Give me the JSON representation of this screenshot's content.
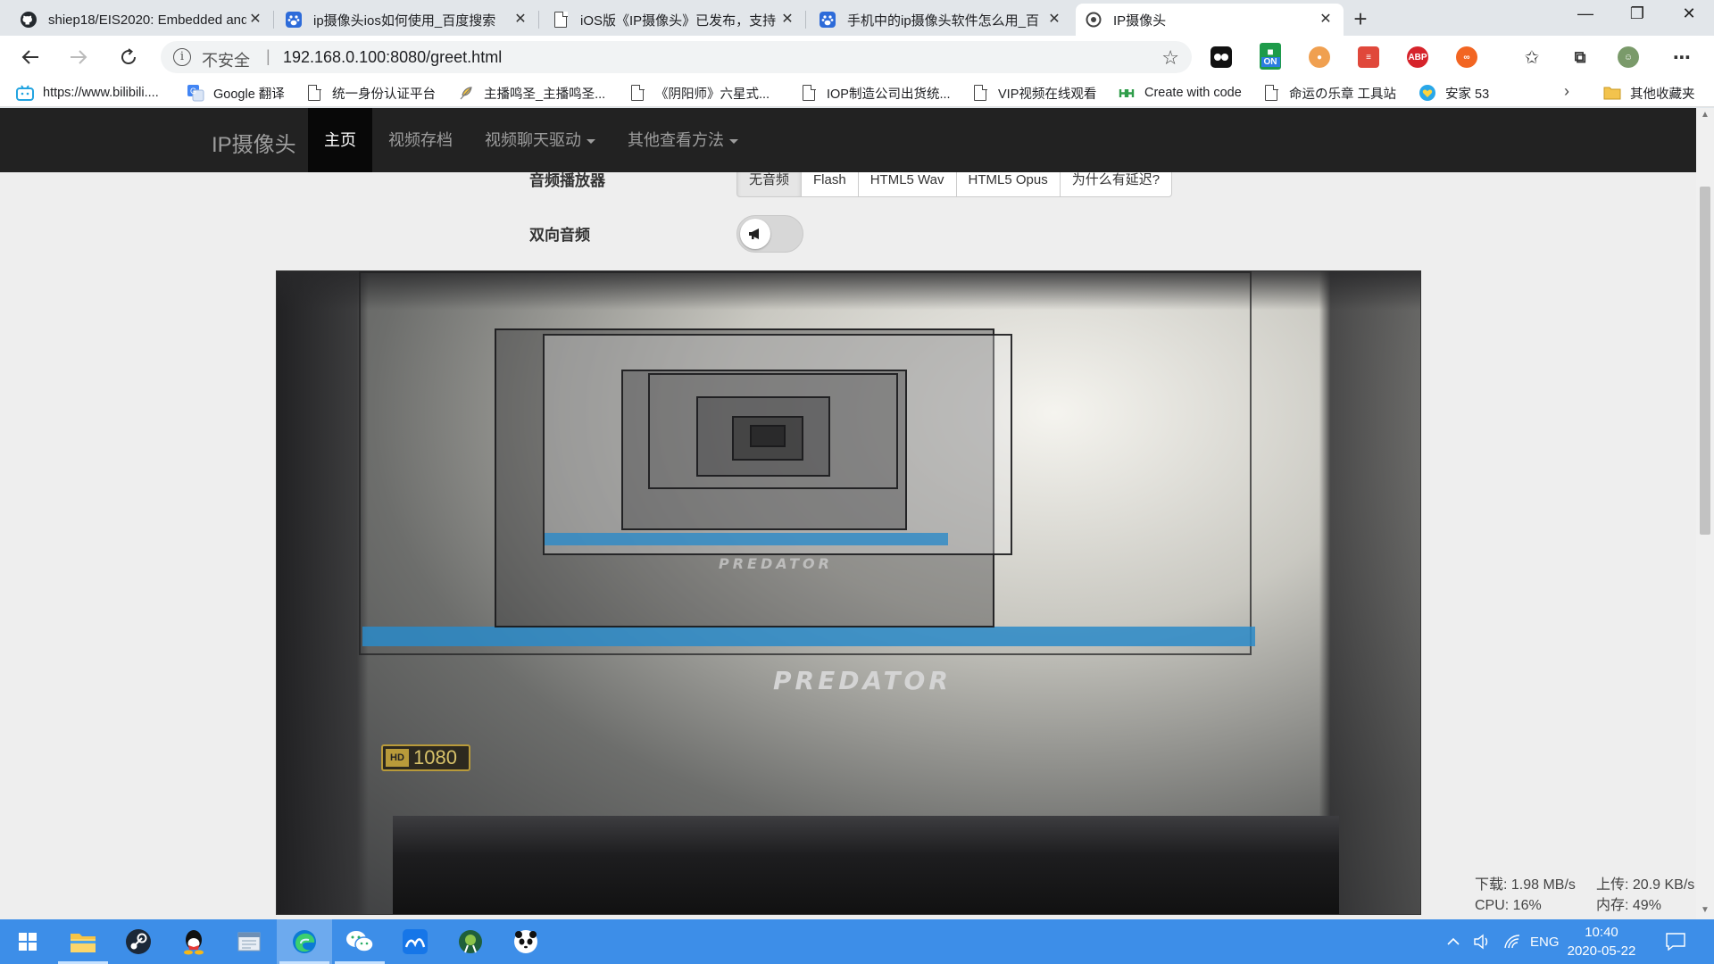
{
  "tabs": [
    {
      "label": "shiep18/EIS2020: Embedded and",
      "icon": "github-icon"
    },
    {
      "label": "ip摄像头ios如何使用_百度搜索",
      "icon": "baidu-paw-icon"
    },
    {
      "label": "iOS版《IP摄像头》已发布，支持",
      "icon": "document-icon"
    },
    {
      "label": "手机中的ip摄像头软件怎么用_百",
      "icon": "baidu-paw-icon"
    },
    {
      "label": "IP摄像头",
      "icon": "site-icon"
    }
  ],
  "address_bar": {
    "security_label": "不安全",
    "url": "192.168.0.100:8080/greet.html"
  },
  "bookmarks": [
    {
      "label": "https://www.bilibili....",
      "icon": "bilibili-icon"
    },
    {
      "label": "Google 翻译",
      "icon": "google-translate-icon"
    },
    {
      "label": "统一身份认证平台",
      "icon": "document-icon"
    },
    {
      "label": "主播鸣圣_主播鸣圣...",
      "icon": "feather-icon"
    },
    {
      "label": "《阴阳师》六星式...",
      "icon": "document-icon"
    },
    {
      "label": "IOP制造公司出货统...",
      "icon": "document-icon"
    },
    {
      "label": "VIP视频在线观看",
      "icon": "document-icon"
    },
    {
      "label": "Create with code",
      "icon": "unity-icon"
    },
    {
      "label": "命运の乐章 工具站",
      "icon": "document-icon"
    },
    {
      "label": "安家 53",
      "icon": "heart-icon"
    },
    {
      "label": "其他收藏夹",
      "icon": "folder-icon"
    }
  ],
  "extensions": {
    "on_badge": "ON",
    "abp_badge": "ABP"
  },
  "navbar": {
    "brand": "IP摄像头",
    "items": [
      "主页",
      "视频存档",
      "视频聊天驱动",
      "其他查看方法"
    ]
  },
  "audio_player": {
    "label": "音频播放器",
    "options": [
      "无音频",
      "Flash",
      "HTML5 Wav",
      "HTML5 Opus",
      "为什么有延迟?"
    ],
    "selected": "无音频"
  },
  "two_way_audio": {
    "label": "双向音频",
    "enabled": false
  },
  "video_stream": {
    "brand_text": "PREDATOR",
    "badge_text": "1080"
  },
  "network_monitor": {
    "download": "下载: 1.98 MB/s",
    "upload": "上传: 20.9 KB/s",
    "cpu": "CPU: 16%",
    "memory": "内存: 49%"
  },
  "taskbar": {
    "apps": [
      "start-icon",
      "file-explorer-icon",
      "steam-icon",
      "qq-icon",
      "notepad-icon",
      "edge-icon",
      "wechat-icon",
      "cloud-app-icon",
      "android-studio-icon",
      "panda-app-icon"
    ],
    "active_app": "edge-icon",
    "language": "ENG",
    "time": "10:40",
    "date": "2020-05-22"
  },
  "colors": {
    "navbar_bg": "#222222",
    "taskbar_bg": "#3d8ee8",
    "page_bg": "#eeeeee",
    "tab_strip_bg": "#e2e6ea"
  }
}
